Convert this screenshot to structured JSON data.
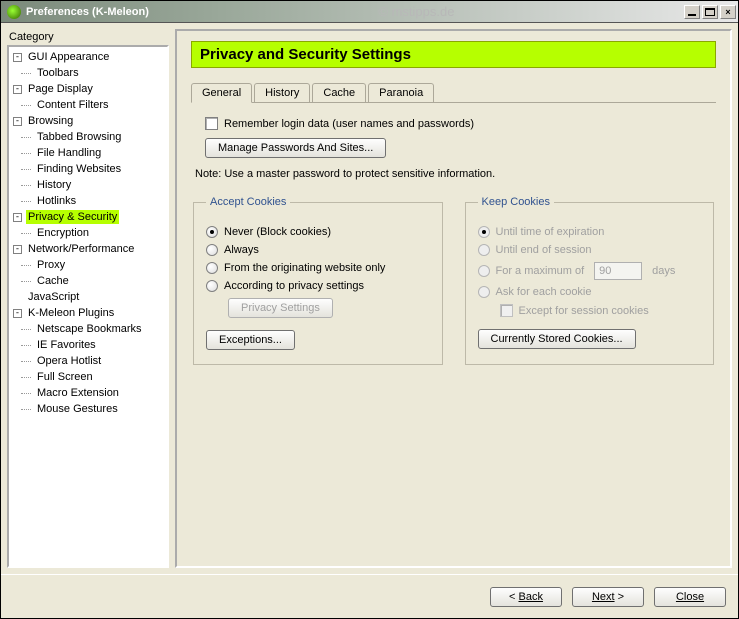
{
  "window": {
    "title": "Preferences (K-Meleon)",
    "watermark": "© mstipps.de"
  },
  "sidebar": {
    "label": "Category",
    "groups": [
      {
        "label": "GUI Appearance",
        "children": [
          {
            "label": "Toolbars"
          }
        ]
      },
      {
        "label": "Page Display",
        "children": [
          {
            "label": "Content Filters"
          }
        ]
      },
      {
        "label": "Browsing",
        "children": [
          {
            "label": "Tabbed Browsing"
          },
          {
            "label": "File Handling"
          },
          {
            "label": "Finding Websites"
          },
          {
            "label": "History"
          },
          {
            "label": "Hotlinks"
          }
        ]
      },
      {
        "label": "Privacy & Security",
        "selected": true,
        "children": [
          {
            "label": "Encryption"
          }
        ]
      },
      {
        "label": "Network/Performance",
        "children": [
          {
            "label": "Proxy"
          },
          {
            "label": "Cache"
          }
        ]
      },
      {
        "label": "JavaScript",
        "leaf": true
      },
      {
        "label": "K-Meleon Plugins",
        "children": [
          {
            "label": "Netscape Bookmarks"
          },
          {
            "label": "IE Favorites"
          },
          {
            "label": "Opera Hotlist"
          },
          {
            "label": "Full Screen"
          },
          {
            "label": "Macro Extension"
          },
          {
            "label": "Mouse Gestures"
          }
        ]
      }
    ]
  },
  "page": {
    "title": "Privacy and Security Settings",
    "tabs": [
      "General",
      "History",
      "Cache",
      "Paranoia"
    ],
    "active_tab": 0,
    "login": {
      "remember_label": "Remember login data (user names and passwords)",
      "remember_checked": false,
      "manage_btn": "Manage Passwords And Sites...",
      "note": "Note: Use a master password to protect sensitive information."
    },
    "accept": {
      "legend": "Accept Cookies",
      "options": [
        "Never (Block cookies)",
        "Always",
        "From the originating website only",
        "According to privacy settings"
      ],
      "selected": 0,
      "privacy_btn": "Privacy Settings",
      "exceptions_btn": "Exceptions..."
    },
    "keep": {
      "legend": "Keep Cookies",
      "options": [
        "Until time of expiration",
        "Until end of session",
        "For a maximum of",
        "Ask for each cookie"
      ],
      "selected": 0,
      "days_value": "90",
      "days_suffix": "days",
      "except_session": "Except for session cookies",
      "stored_btn": "Currently Stored Cookies..."
    }
  },
  "footer": {
    "back": "Back",
    "next": "Next",
    "close": "Close"
  }
}
